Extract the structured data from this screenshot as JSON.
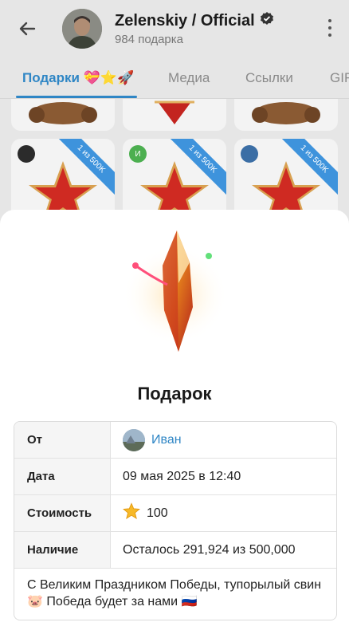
{
  "header": {
    "back_icon": "back-arrow-icon",
    "channel_name": "Zelenskiy / Official",
    "verified_icon": "verified-badge-icon",
    "subtitle": "984 подарка",
    "menu_icon": "more-vertical-icon"
  },
  "tabs": [
    {
      "label": "Подарки 💝⭐🚀",
      "active": true
    },
    {
      "label": "Медиа",
      "active": false
    },
    {
      "label": "Ссылки",
      "active": false
    },
    {
      "label": "GIF",
      "active": false
    }
  ],
  "grid": {
    "ribbon_text": "1 из 500K",
    "badges": [
      "",
      "И",
      ""
    ]
  },
  "sheet": {
    "title": "Подарок",
    "rows": {
      "from": {
        "label": "От",
        "value": "Иван"
      },
      "date": {
        "label": "Дата",
        "value": "09 мая 2025 в 12:40"
      },
      "price": {
        "label": "Стоимость",
        "value": "100",
        "icon": "star-icon"
      },
      "availability": {
        "label": "Наличие",
        "value": "Осталось 291,924 из 500,000"
      }
    },
    "message": "С Великим Праздником Победы, тупорылый свин🐷 Победа будет за нами 🇷🇺"
  },
  "colors": {
    "accent": "#2f86c5",
    "ribbon": "#3e93dc",
    "background": "#e6e6e6"
  }
}
